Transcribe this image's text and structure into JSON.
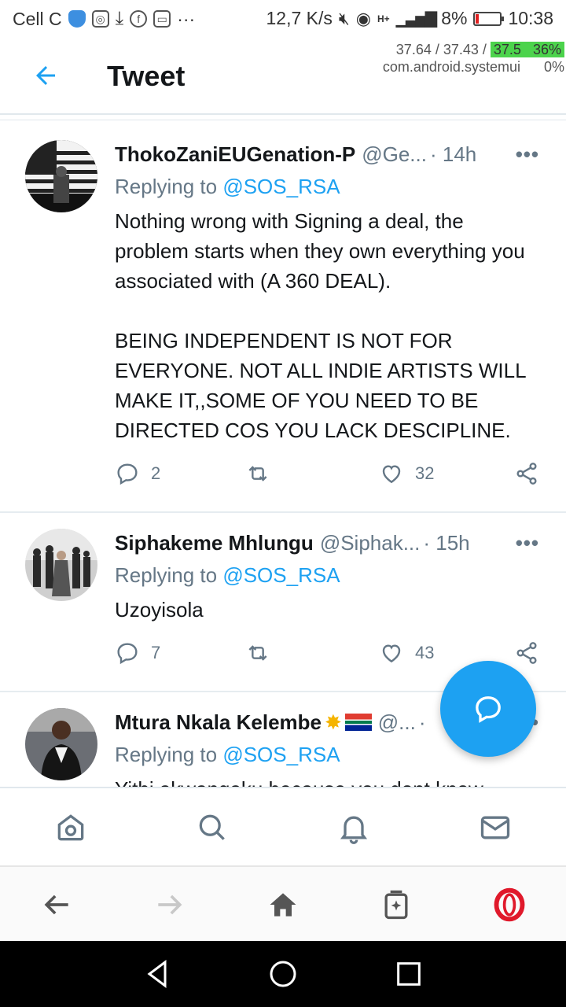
{
  "status_bar": {
    "carrier": "Cell C",
    "speed": "12,7 K/s",
    "network": "H+",
    "battery": "8%",
    "time": "10:38",
    "more": "···"
  },
  "overlay": {
    "line1_a": "37.64 / 37.43 /",
    "line1_b": "37.5",
    "line1_c": "36%",
    "line2_a": "com.android.systemui",
    "line2_b": "0%"
  },
  "header": {
    "title": "Tweet",
    "back_icon": "arrow-left-icon"
  },
  "tweets": [
    {
      "name": "ThokoZaniEUGenation-P",
      "handle": "@Ge...",
      "time": "· 14h",
      "more": "•••",
      "replying_prefix": "Replying to ",
      "replying_to": "@SOS_RSA",
      "text": "Nothing wrong with Signing a deal, the problem starts when they own everything you associated with (A 360 DEAL).\n\nBEING INDEPENDENT IS NOT FOR EVERYONE. NOT ALL INDIE ARTISTS WILL MAKE IT,,SOME OF YOU NEED TO BE DIRECTED COS YOU LACK DESCIPLINE.",
      "replies": "2",
      "retweets": "",
      "likes": "32"
    },
    {
      "name": "Siphakeme Mhlungu",
      "handle": "@Siphak...",
      "time": "· 15h",
      "more": "•••",
      "replying_prefix": "Replying to ",
      "replying_to": "@SOS_RSA",
      "text": "Uzoyisola",
      "replies": "7",
      "retweets": "",
      "likes": "43"
    },
    {
      "name": "Mtura Nkala Kelembe",
      "handle": "@...",
      "time": "·",
      "more": "•••",
      "replying_prefix": "Replying to ",
      "replying_to": "@SOS_RSA",
      "text": "Yithi akwangaku because you dont know"
    }
  ],
  "colors": {
    "accent": "#1da1f2",
    "muted": "#657786",
    "text": "#14171a",
    "opera_red": "#e0192b"
  },
  "icons": {
    "reply": "reply-icon",
    "retweet": "retweet-icon",
    "like": "heart-icon",
    "share": "share-icon",
    "compose": "compose-tweet-icon"
  },
  "twitter_nav": [
    "home-icon",
    "search-icon",
    "notifications-icon",
    "messages-icon"
  ],
  "browser_nav": [
    "back-icon",
    "forward-icon",
    "home-icon",
    "tabs-icon",
    "opera-menu-icon"
  ],
  "system_nav": [
    "back-triangle-icon",
    "home-circle-icon",
    "recents-square-icon"
  ]
}
